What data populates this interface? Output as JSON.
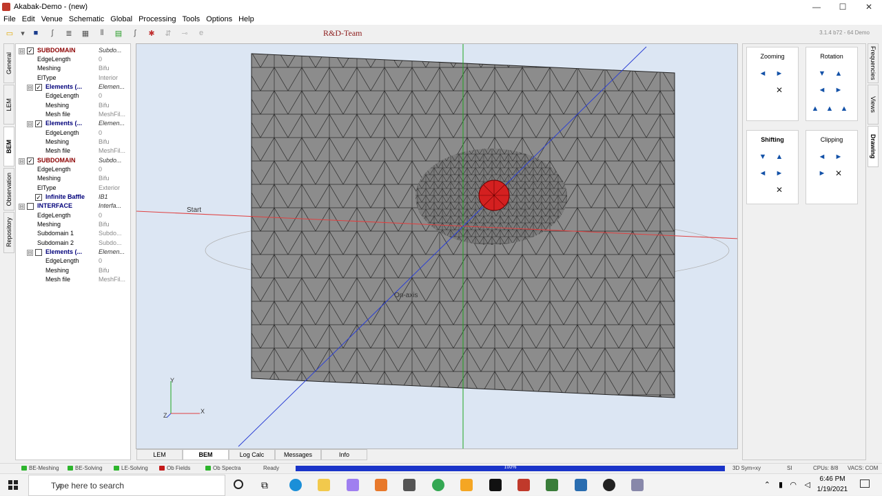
{
  "window": {
    "title": "Akabak-Demo - (new)",
    "minimize": "—",
    "maximize": "☐",
    "close": "✕"
  },
  "menu": [
    "File",
    "Edit",
    "Venue",
    "Schematic",
    "Global",
    "Processing",
    "Tools",
    "Options",
    "Help"
  ],
  "toolbar": {
    "title": "R&D-Team",
    "version": "3.1.4 b72 - 64 Demo"
  },
  "left_tabs": [
    "General",
    "LEM",
    "BEM",
    "Observation",
    "Repository"
  ],
  "tree": [
    {
      "name": "SUBDOMAIN",
      "value": "Subdo...",
      "style": "bold-red",
      "expand": "⊟",
      "check": "✓"
    },
    {
      "name": "EdgeLength",
      "value": "0"
    },
    {
      "name": "Meshing",
      "value": "Bifu"
    },
    {
      "name": "ElType",
      "value": "Interior"
    },
    {
      "name": "Elements (...",
      "value": "Elemen...",
      "style": "bold-blue",
      "expand": "⊟",
      "check": "✓"
    },
    {
      "name": "EdgeLength",
      "value": "0"
    },
    {
      "name": "Meshing",
      "value": "Bifu"
    },
    {
      "name": "Mesh file",
      "value": "MeshFil..."
    },
    {
      "name": "Elements (...",
      "value": "Elemen...",
      "style": "bold-blue",
      "expand": "⊟",
      "check": "✓"
    },
    {
      "name": "EdgeLength",
      "value": "0"
    },
    {
      "name": "Meshing",
      "value": "Bifu"
    },
    {
      "name": "Mesh file",
      "value": "MeshFil..."
    },
    {
      "name": "SUBDOMAIN",
      "value": "Subdo...",
      "style": "bold-red",
      "expand": "⊟",
      "check": "✓"
    },
    {
      "name": "EdgeLength",
      "value": "0"
    },
    {
      "name": "Meshing",
      "value": "Bifu"
    },
    {
      "name": "ElType",
      "value": "Exterior"
    },
    {
      "name": "Infinite Baffle",
      "value": "IB1",
      "style": "bold-blue",
      "check": "✓"
    },
    {
      "name": "INTERFACE",
      "value": "Interfa...",
      "style": "bold-blue",
      "expand": "⊟",
      "check": ""
    },
    {
      "name": "EdgeLength",
      "value": "0"
    },
    {
      "name": "Meshing",
      "value": "Bifu"
    },
    {
      "name": "Subdomain 1",
      "value": "Subdo..."
    },
    {
      "name": "Subdomain 2",
      "value": "Subdo..."
    },
    {
      "name": "Elements (...",
      "value": "Elemen...",
      "style": "bold-blue",
      "expand": "⊟",
      "check": ""
    },
    {
      "name": "EdgeLength",
      "value": "0"
    },
    {
      "name": "Meshing",
      "value": "Bifu"
    },
    {
      "name": "Mesh file",
      "value": "MeshFil..."
    }
  ],
  "viewport": {
    "label_start": "Start",
    "label_onaxis": "On-axis",
    "axis_y": "Y",
    "axis_x": "X",
    "axis_z": "Z"
  },
  "bottom_tabs": [
    "LEM",
    "BEM",
    "Log Calc",
    "Messages",
    "Info"
  ],
  "right_panel": {
    "zooming": "Zooming",
    "rotation": "Rotation",
    "shifting": "Shifting",
    "clipping": "Clipping"
  },
  "right_tabs": [
    "Frequencies",
    "Views",
    "Drawing"
  ],
  "status": {
    "items": [
      {
        "label": "BE-Meshing",
        "color": "#2db52d"
      },
      {
        "label": "BE-Solving",
        "color": "#2db52d"
      },
      {
        "label": "LE-Solving",
        "color": "#2db52d"
      },
      {
        "label": "Ob Fields",
        "color": "#c41a1a"
      },
      {
        "label": "Ob Spectra",
        "color": "#2db52d"
      }
    ],
    "ready": "Ready",
    "progress": "100%",
    "sym": "3D Sym=xy",
    "units": "SI",
    "cpus": "CPUs: 8/8",
    "vacs": "VACS: COM"
  },
  "taskbar": {
    "search": "Type here to search",
    "time": "6:46 PM",
    "date": "1/19/2021"
  }
}
